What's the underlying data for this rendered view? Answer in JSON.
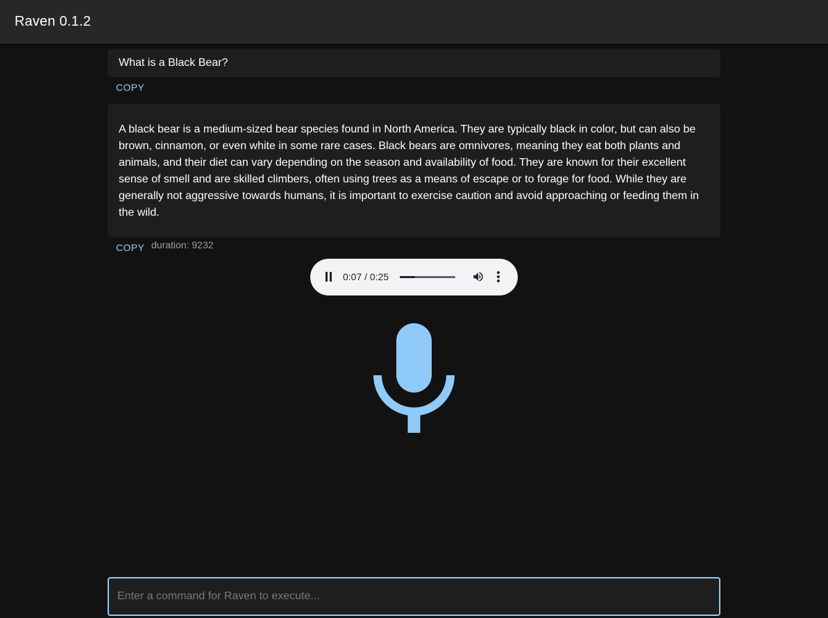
{
  "app": {
    "title": "Raven 0.1.2"
  },
  "conversation": {
    "question": "What is a Black Bear?",
    "answer": "A black bear is a medium-sized bear species found in North America. They are typically black in color, but can also be brown, cinnamon, or even white in some rare cases. Black bears are omnivores, meaning they eat both plants and animals, and their diet can vary depending on the season and availability of food. They are known for their excellent sense of smell and are skilled climbers, often using trees as a means of escape or to forage for food. While they are generally not aggressive towards humans, it is important to exercise caution and avoid approaching or feeding them in the wild.",
    "copy_label": "COPY",
    "duration_text": "duration: 9232"
  },
  "audio": {
    "time_text": "0:07 / 0:25",
    "progress_fraction": 0.28,
    "state": "playing",
    "icons": {
      "pause": "pause-icon",
      "volume": "volume-icon",
      "more": "more-vert-icon"
    }
  },
  "mic": {
    "icon": "microphone-icon",
    "color": "#90caf9"
  },
  "command_input": {
    "value": "",
    "placeholder": "Enter a command for Raven to execute..."
  },
  "colors": {
    "accent": "#90caf9",
    "background": "#121212",
    "surface": "#1e1e1e",
    "app_bar": "#272727"
  }
}
